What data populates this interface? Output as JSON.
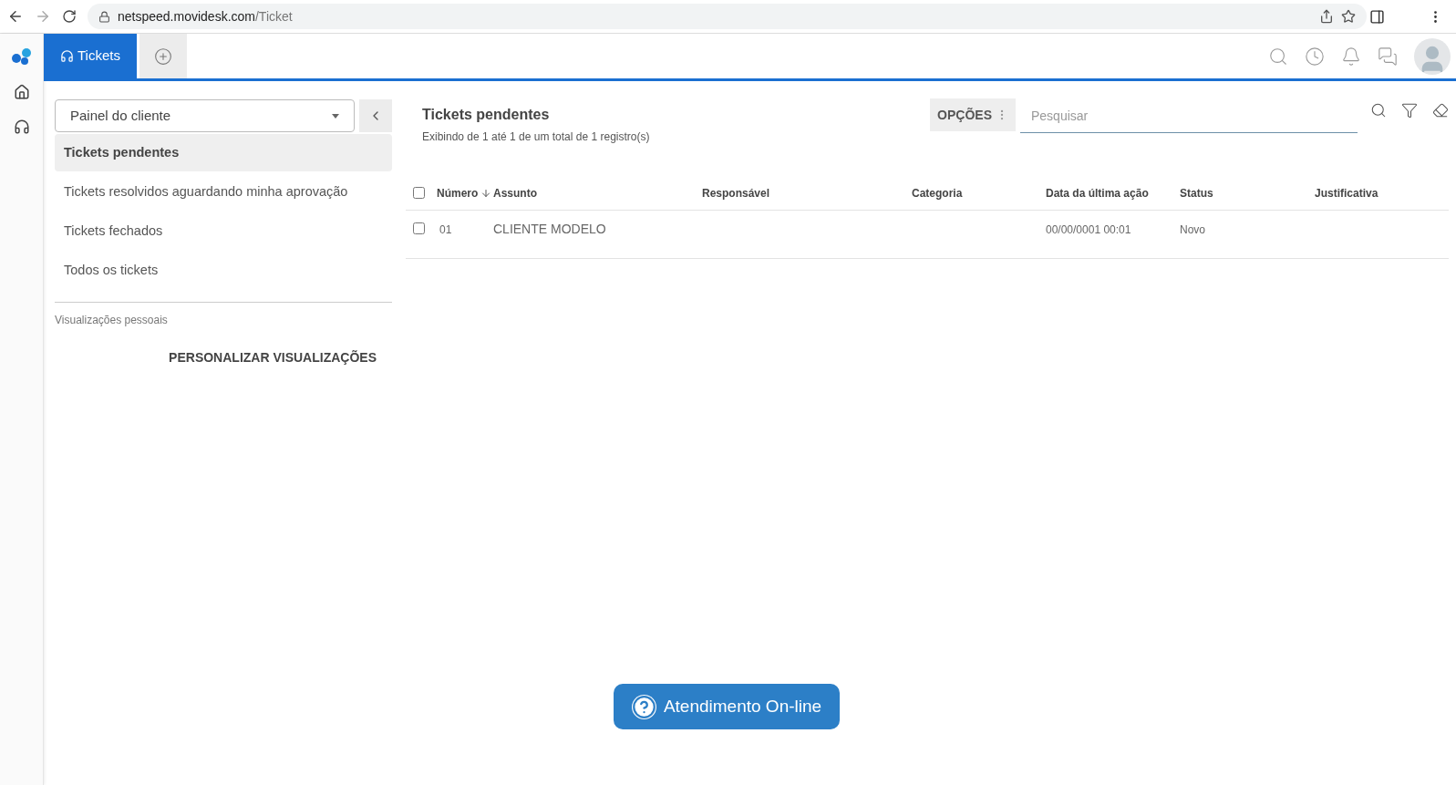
{
  "browser": {
    "url_host": "netspeed.movidesk.com",
    "url_path": "/Ticket"
  },
  "tabs": [
    {
      "label": "Tickets",
      "selected": true
    }
  ],
  "sidebar": {
    "dropdown": {
      "value": "Painel do cliente"
    },
    "items": [
      {
        "label": "Tickets pendentes",
        "selected": true
      },
      {
        "label": "Tickets resolvidos aguardando minha aprovação",
        "selected": false
      },
      {
        "label": "Tickets fechados",
        "selected": false
      },
      {
        "label": "Todos os tickets",
        "selected": false
      }
    ],
    "section_label": "Visualizações pessoais",
    "customize_button": "PERSONALIZAR VISUALIZAÇÕES"
  },
  "main": {
    "title": "Tickets pendentes",
    "subtitle": "Exibindo de 1 até 1 de um total de 1 registro(s)",
    "options_button": "OPÇÕES",
    "search": {
      "placeholder": "Pesquisar"
    }
  },
  "table": {
    "select_all": {
      "checked": false
    },
    "columns": [
      {
        "label": "Número",
        "sorted": true
      },
      {
        "label": "Assunto",
        "sorted": false
      },
      {
        "label": "Responsável",
        "sorted": false
      },
      {
        "label": "Categoria",
        "sorted": false
      },
      {
        "label": "Data da última ação",
        "sorted": false
      },
      {
        "label": "Status",
        "sorted": false
      },
      {
        "label": "Justificativa",
        "sorted": false
      }
    ],
    "rows": [
      {
        "checked": false,
        "cells": [
          "01",
          "CLIENTE MODELO",
          "",
          "",
          "00/00/0001 00:01",
          "Novo",
          ""
        ]
      }
    ]
  },
  "chat_button": "Atendimento On-line"
}
